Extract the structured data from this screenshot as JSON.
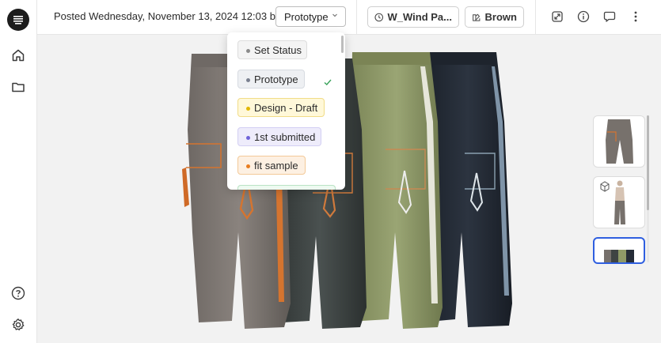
{
  "header": {
    "posted_text": "Posted Wednesday, November 13, 2024 12:03 b...",
    "status_value": "Prototype",
    "product_name": "W_Wind Pa...",
    "colorway_name": "Brown"
  },
  "status_options": [
    {
      "label": "Set Status",
      "dot": "#8a8a8a",
      "bg": "#f4f4f4",
      "border": "#dddddd",
      "selected": false
    },
    {
      "label": "Prototype",
      "dot": "#7a8090",
      "bg": "#eef0f3",
      "border": "#d7dbe1",
      "selected": true
    },
    {
      "label": "Design - Draft",
      "dot": "#e2b600",
      "bg": "#fff8d9",
      "border": "#f1dc86",
      "selected": false
    },
    {
      "label": "1st submitted",
      "dot": "#6f63d9",
      "bg": "#eeecfb",
      "border": "#d3cff3",
      "selected": false
    },
    {
      "label": "fit sample",
      "dot": "#e87d1f",
      "bg": "#fdf0e2",
      "border": "#f3c998",
      "selected": false
    }
  ],
  "colors": {
    "accent": "#2f5fe0",
    "check": "#3aa35b",
    "pant_gray": "#7a7470",
    "pant_charcoal": "#3f4443",
    "pant_olive": "#8f9a67",
    "pant_navy": "#252c37",
    "trim_orange": "#d5742f"
  },
  "icons": {
    "logo": "app-logo-icon",
    "home": "home-icon",
    "folder": "folder-icon",
    "help": "help-icon",
    "settings": "gear-icon",
    "clock": "clock-icon",
    "palette": "palette-icon",
    "expand": "expand-icon",
    "info": "info-icon",
    "comment": "comment-icon",
    "more": "more-vertical-icon",
    "check": "check-icon",
    "chevron": "chevron-down-icon"
  }
}
